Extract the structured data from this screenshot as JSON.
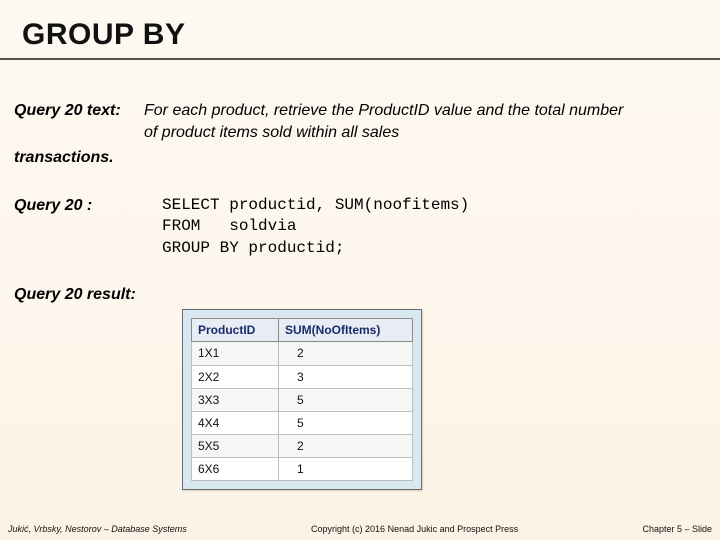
{
  "title": "GROUP BY",
  "query_text_label": "Query 20 text:",
  "query_text_body": "For each product, retrieve the ProductID value and the total number",
  "query_text_body2": "of product items sold within all sales",
  "transactions_label": "transactions.",
  "query_label": "Query 20 :",
  "sql_line1": "SELECT productid, SUM(noofitems)",
  "sql_line2": "FROM   soldvia",
  "sql_line3": "GROUP BY productid;",
  "result_label": "Query 20 result:",
  "table_headers": {
    "c1": "ProductID",
    "c2": "SUM(NoOfItems)"
  },
  "chart_data": {
    "type": "table",
    "columns": [
      "ProductID",
      "SUM(NoOfItems)"
    ],
    "rows": [
      {
        "ProductID": "1X1",
        "SUM(NoOfItems)": 2
      },
      {
        "ProductID": "2X2",
        "SUM(NoOfItems)": 3
      },
      {
        "ProductID": "3X3",
        "SUM(NoOfItems)": 5
      },
      {
        "ProductID": "4X4",
        "SUM(NoOfItems)": 5
      },
      {
        "ProductID": "5X5",
        "SUM(NoOfItems)": 2
      },
      {
        "ProductID": "6X6",
        "SUM(NoOfItems)": 1
      }
    ]
  },
  "footer": {
    "left": "Jukić, Vrbsky, Nestorov – Database Systems",
    "center": "Copyright (c) 2016 Nenad Jukic and Prospect Press",
    "right": "Chapter 5 – Slide"
  }
}
